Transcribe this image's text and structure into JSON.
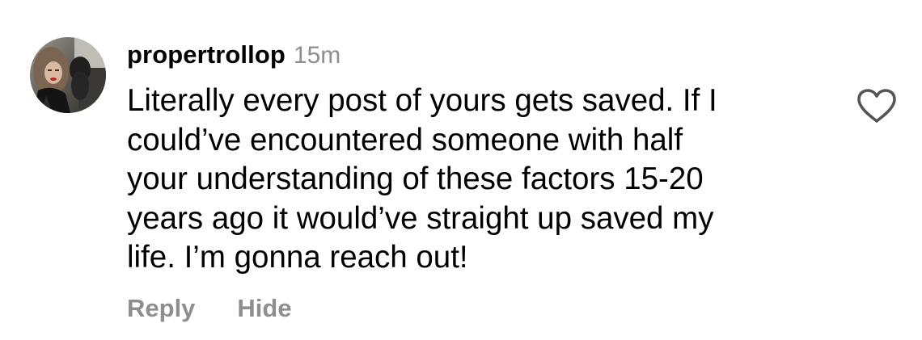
{
  "comment": {
    "author": {
      "username": "propertrollop",
      "avatar": "profile-photo"
    },
    "timestamp": "15m",
    "text_lines": [
      "Literally every post of yours gets saved. If I",
      "could’ve encountered someone with half",
      "your understanding of these factors 15-20",
      "years ago it would’ve straight up saved my",
      "life. I’m gonna reach out!"
    ],
    "like_icon": "heart-outline-icon",
    "actions": {
      "reply_label": "Reply",
      "hide_label": "Hide"
    }
  },
  "colors": {
    "text_primary": "#000000",
    "text_secondary": "#8e8e8e",
    "background": "#ffffff"
  }
}
